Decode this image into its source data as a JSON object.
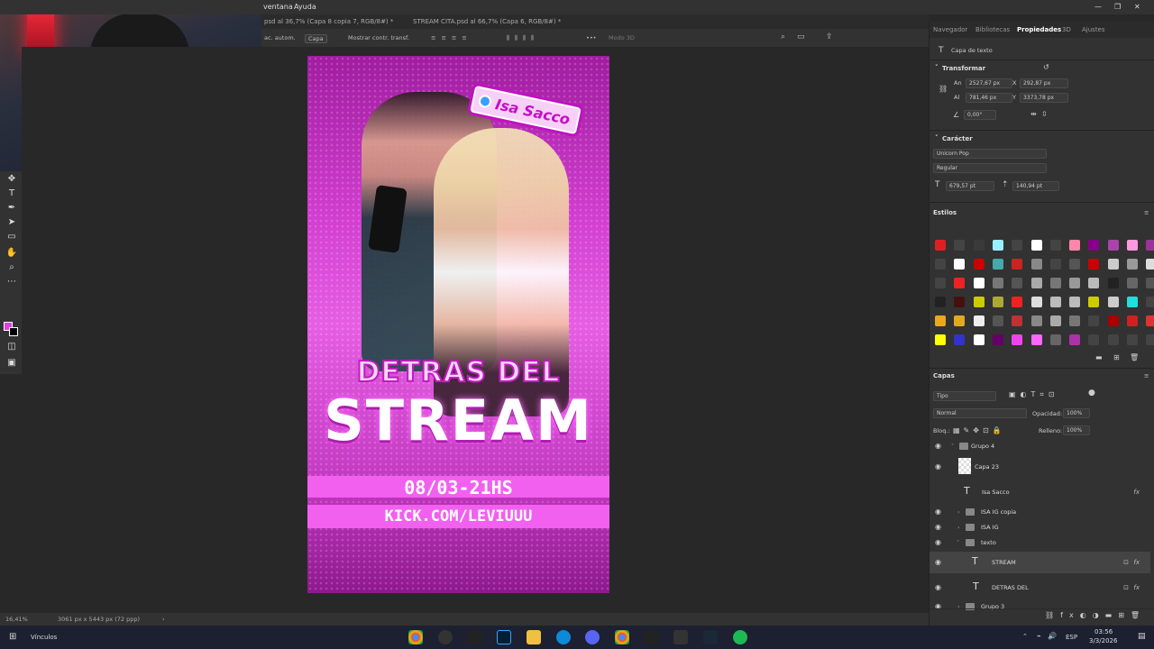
{
  "menubar": {
    "items": [
      "ventana",
      "Ayuda"
    ]
  },
  "tabs": [
    {
      "label": "psd al 36,7% (Capa 8 copia 7, RGB/8#) *"
    },
    {
      "label": "STREAM CITA.psd al 66,7% (Capa 6, RGB/8#) *"
    }
  ],
  "options": {
    "auto_select": "ac. autom.",
    "layer_select": "Capa",
    "show_transform": "Mostrar contr. transf.",
    "mode3d": "Modo 3D"
  },
  "poster": {
    "badge": "Isa Sacco",
    "line1": "DETRAS DEL",
    "line2": "STREAM",
    "date": "08/03-21HS",
    "url": "KICK.COM/LEVIUUU"
  },
  "statusbar": {
    "zoom": "16,41%",
    "docsize": "3061 px x 5443 px (72 ppp)"
  },
  "panel": {
    "tabs": [
      "Navegador",
      "Bibliotecas",
      "Propiedades",
      "3D",
      "Ajustes"
    ],
    "layer_kind": "Capa de texto",
    "transform": {
      "title": "Transformar",
      "an": "2527,67 px",
      "x": "292,87 px",
      "al": "781,46 px",
      "y": "3373,78 px",
      "angle": "0,00°"
    },
    "character": {
      "title": "Carácter",
      "font": "Unicorn Pop",
      "style": "Regular",
      "size": "679,57 pt",
      "leading": "140,94 pt"
    },
    "styles": {
      "title": "Estilos"
    },
    "layers": {
      "title": "Capas",
      "filter": "Tipo",
      "blend": "Normal",
      "opacity_label": "Opacidad:",
      "opacity": "100%",
      "lock_label": "Bloq.:",
      "fill_label": "Relleno:",
      "fill": "100%",
      "items": [
        {
          "name": "Grupo 4"
        },
        {
          "name": "Capa 23"
        },
        {
          "name": "Isa Sacco"
        },
        {
          "name": "ISA IG copia"
        },
        {
          "name": "ISA IG"
        },
        {
          "name": "texto"
        },
        {
          "name": "STREAM"
        },
        {
          "name": "DETRAS DEL"
        },
        {
          "name": "Grupo 3"
        }
      ]
    }
  },
  "taskbar": {
    "vinculos": "Vínculos",
    "lang": "ESP",
    "time": "03:56",
    "date": "3/3/2026"
  },
  "colors": {
    "poster": "#d23ed0",
    "fg": "#e040e0"
  }
}
